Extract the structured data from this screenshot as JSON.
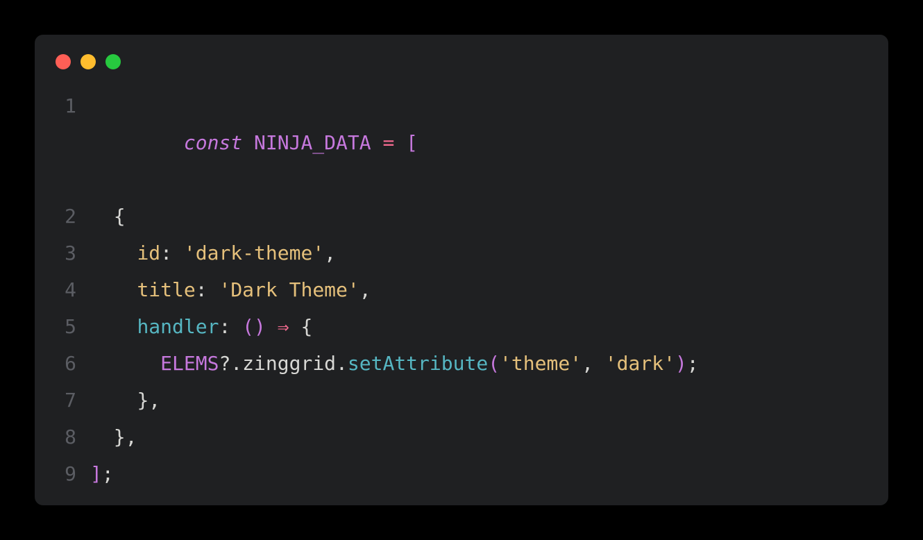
{
  "traffic": {
    "red": "#ff5f56",
    "yellow": "#ffbd2e",
    "green": "#27c93f"
  },
  "code": {
    "lineNumbers": [
      "1",
      "2",
      "3",
      "4",
      "5",
      "6",
      "7",
      "8",
      "9"
    ],
    "l1": {
      "const": "const",
      "sp1": " ",
      "ident": "NINJA_DATA",
      "sp2": " ",
      "eq": "=",
      "sp3": " ",
      "lbrack": "["
    },
    "l2": {
      "indent": "  ",
      "lbrace": "{"
    },
    "l3": {
      "indent": "    ",
      "key": "id",
      "colon": ":",
      "sp": " ",
      "q1": "'",
      "val": "dark-theme",
      "q2": "'",
      "comma": ","
    },
    "l4": {
      "indent": "    ",
      "key": "title",
      "colon": ":",
      "sp": " ",
      "q1": "'",
      "val": "Dark Theme",
      "q2": "'",
      "comma": ","
    },
    "l5": {
      "indent": "    ",
      "key": "handler",
      "colon": ":",
      "sp": " ",
      "lp": "(",
      "rp": ")",
      "sp2": " ",
      "arrow": "⇒",
      "sp3": " ",
      "lbrace": "{"
    },
    "l6": {
      "indent": "      ",
      "obj": "ELEMS",
      "opt": "?.",
      "prop": "zinggrid",
      "dot": ".",
      "method": "setAttribute",
      "lp": "(",
      "q1": "'",
      "arg1": "theme",
      "q2": "'",
      "comma": ",",
      "sp": " ",
      "q3": "'",
      "arg2": "dark",
      "q4": "'",
      "rp": ")",
      "semi": ";"
    },
    "l7": {
      "indent": "    ",
      "rbrace": "}",
      "comma": ","
    },
    "l8": {
      "indent": "  ",
      "rbrace": "}",
      "comma": ","
    },
    "l9": {
      "rbrack": "]",
      "semi": ";"
    }
  }
}
